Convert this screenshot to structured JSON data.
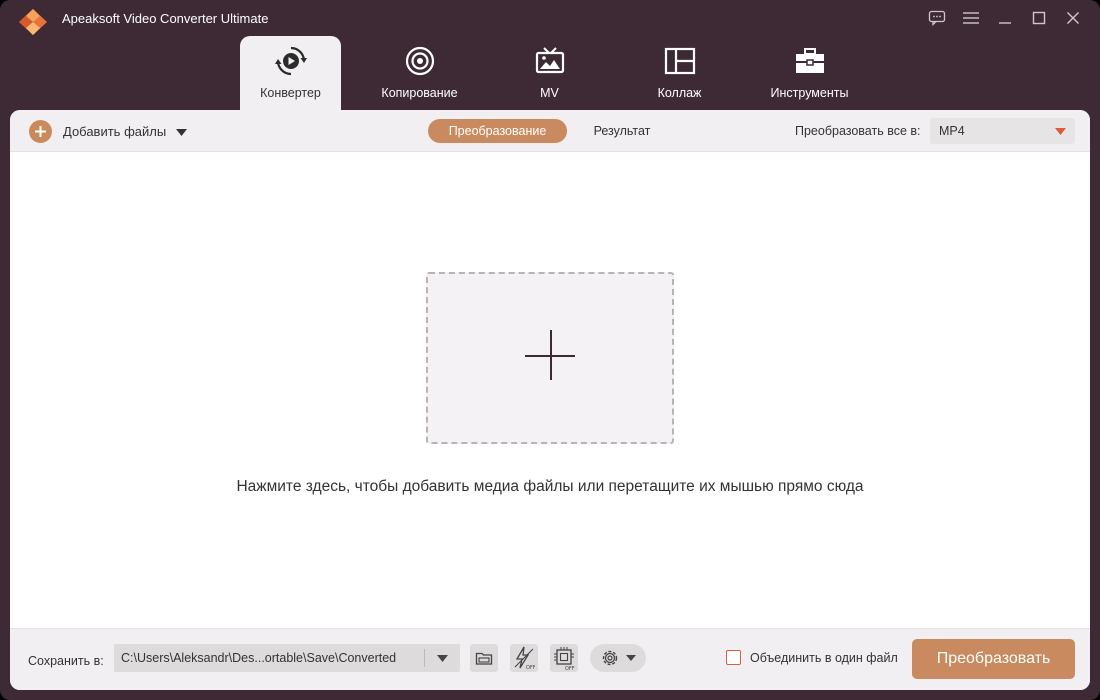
{
  "window": {
    "title": "Apeaksoft Video Converter Ultimate",
    "controls": [
      "feedback-icon",
      "menu-icon",
      "minimize-icon",
      "maximize-icon",
      "close-icon"
    ]
  },
  "tabs": [
    {
      "label": "Конвертер",
      "icon": "converter-icon",
      "active": true
    },
    {
      "label": "Копирование",
      "icon": "disc-icon",
      "active": false
    },
    {
      "label": "MV",
      "icon": "mv-tv-icon",
      "active": false
    },
    {
      "label": "Коллаж",
      "icon": "collage-icon",
      "active": false
    },
    {
      "label": "Инструменты",
      "icon": "toolbox-icon",
      "active": false
    }
  ],
  "toolbar": {
    "add_files_label": "Добавить файлы",
    "segments": [
      {
        "label": "Преобразование",
        "active": true
      },
      {
        "label": "Результат",
        "active": false
      }
    ],
    "convert_all_label": "Преобразовать все в:",
    "convert_all_value": "MP4"
  },
  "dropzone": {
    "hint": "Нажмите здесь, чтобы добавить медиа файлы или перетащите их мышью прямо сюда"
  },
  "bottom": {
    "save_to_label": "Сохранить в:",
    "save_path": "C:\\Users\\Aleksandr\\Des...ortable\\Save\\Converted",
    "tools": [
      "open-folder-icon",
      "hardware-acceleration-off-icon",
      "gpu-off-icon",
      "settings-gear-icon"
    ],
    "merge_label": "Объединить в один файл",
    "merge_checked": false,
    "convert_label": "Преобразовать"
  },
  "colors": {
    "window_bg": "#3e2a35",
    "accent": "#c98a5f",
    "logo_orange": "#e8733a",
    "checkbox_border": "#e05a3a"
  }
}
